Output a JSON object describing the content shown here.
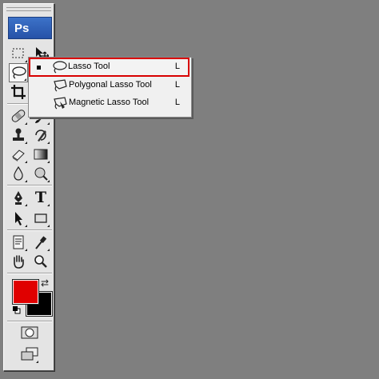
{
  "app": {
    "logo_text": "Ps"
  },
  "toolbox": {
    "tools": [
      {
        "name": "marquee-tool",
        "icon": "marquee-icon"
      },
      {
        "name": "move-tool",
        "icon": "move-icon"
      },
      {
        "name": "lasso-tool",
        "icon": "lasso-icon",
        "active": true
      },
      {
        "name": "magic-wand-tool",
        "icon": "magic-wand-icon"
      },
      {
        "name": "crop-tool",
        "icon": "crop-icon"
      },
      {
        "name": "slice-tool",
        "icon": "slice-icon"
      },
      {
        "name": "healing-brush-tool",
        "icon": "bandage-icon"
      },
      {
        "name": "brush-tool",
        "icon": "brush-icon"
      },
      {
        "name": "clone-stamp-tool",
        "icon": "stamp-icon"
      },
      {
        "name": "history-brush-tool",
        "icon": "history-brush-icon"
      },
      {
        "name": "eraser-tool",
        "icon": "eraser-icon"
      },
      {
        "name": "gradient-tool",
        "icon": "gradient-icon"
      },
      {
        "name": "blur-tool",
        "icon": "drop-icon"
      },
      {
        "name": "dodge-tool",
        "icon": "dodge-icon"
      },
      {
        "name": "pen-tool",
        "icon": "pen-icon"
      },
      {
        "name": "type-tool",
        "icon": "type-icon",
        "glyph": "T"
      },
      {
        "name": "path-selection-tool",
        "icon": "arrow-icon"
      },
      {
        "name": "shape-tool",
        "icon": "rectangle-icon"
      },
      {
        "name": "notes-tool",
        "icon": "notes-icon"
      },
      {
        "name": "eyedropper-tool",
        "icon": "eyedropper-icon"
      },
      {
        "name": "hand-tool",
        "icon": "hand-icon"
      },
      {
        "name": "zoom-tool",
        "icon": "zoom-icon"
      }
    ],
    "foreground_color": "#e00000",
    "background_color": "#000000",
    "swap_glyph": "⇄"
  },
  "flyout": {
    "items": [
      {
        "label": "Lasso Tool",
        "shortcut": "L",
        "selected": true,
        "icon": "lasso-icon"
      },
      {
        "label": "Polygonal Lasso Tool",
        "shortcut": "L",
        "selected": false,
        "icon": "polygonal-lasso-icon"
      },
      {
        "label": "Magnetic Lasso Tool",
        "shortcut": "L",
        "selected": false,
        "icon": "magnetic-lasso-icon"
      }
    ]
  }
}
